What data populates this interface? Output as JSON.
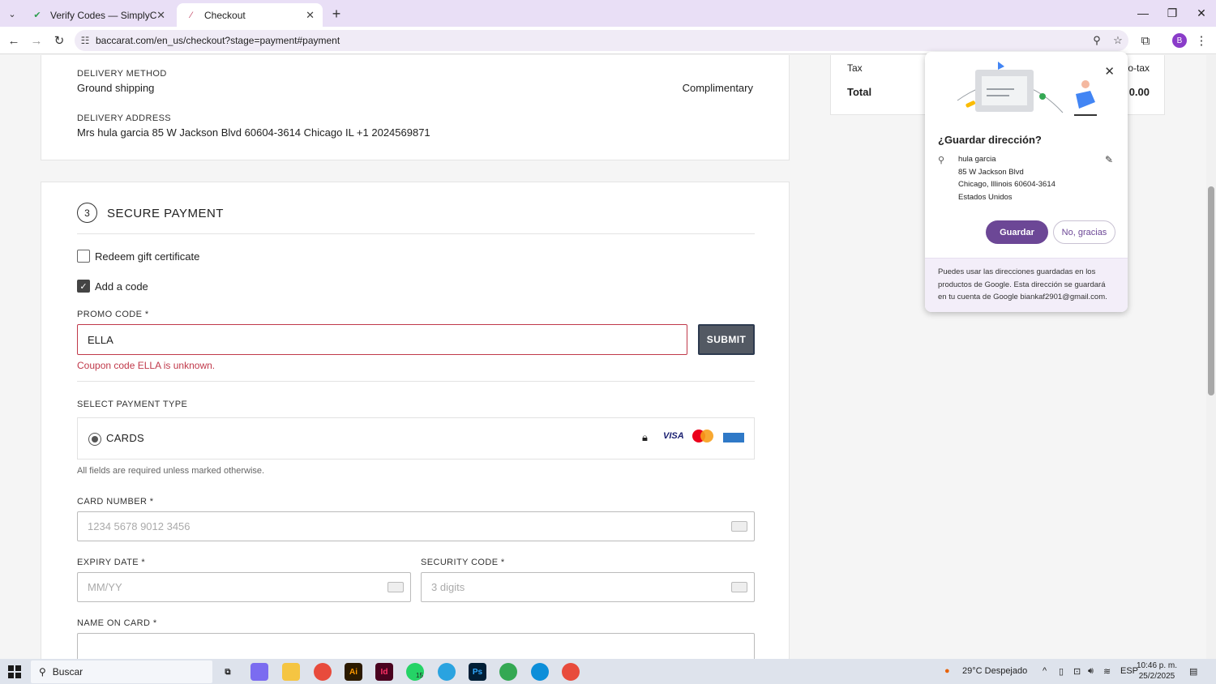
{
  "browser": {
    "tabs": [
      {
        "title": "Verify Codes — SimplyCodes",
        "active": false
      },
      {
        "title": "Checkout",
        "active": true
      }
    ],
    "url": "baccarat.com/en_us/checkout?stage=payment#payment"
  },
  "delivery": {
    "method_label": "DELIVERY METHOD",
    "method_value": "Ground shipping",
    "method_price": "Complimentary",
    "address_label": "DELIVERY ADDRESS",
    "address_value": "Mrs hula garcia 85 W Jackson Blvd 60604-3614 Chicago IL +1 2024569871"
  },
  "summary": {
    "tax_label": "Tax",
    "tax_value_partial": "o-tax",
    "total_label": "Total",
    "total_value_partial": "0.00"
  },
  "payment": {
    "step_number": "3",
    "title": "SECURE PAYMENT",
    "redeem_label": "Redeem gift certificate",
    "add_code_label": "Add a code",
    "promo_label": "PROMO CODE *",
    "promo_value": "ELLA",
    "submit_label": "SUBMIT",
    "promo_error": "Coupon code ELLA is unknown.",
    "select_type_label": "SELECT PAYMENT TYPE",
    "cards_label": "CARDS",
    "card_brands": [
      "VISA",
      "mastercard",
      "AMEX"
    ],
    "required_note": "All fields are required unless marked otherwise.",
    "card_number_label": "CARD NUMBER *",
    "card_number_placeholder": "1234 5678 9012 3456",
    "expiry_label": "EXPIRY DATE *",
    "expiry_placeholder": "MM/YY",
    "security_label": "SECURITY CODE *",
    "security_placeholder": "3 digits",
    "name_label": "NAME ON CARD *"
  },
  "popup": {
    "title": "¿Guardar dirección?",
    "address_lines": [
      "hula garcia",
      "85 W Jackson Blvd",
      "Chicago, Illinois 60604-3614",
      "Estados Unidos"
    ],
    "save_label": "Guardar",
    "decline_label": "No, gracias",
    "footer": "Puedes usar las direcciones guardadas en los productos de Google. Esta dirección se guardará en tu cuenta de Google biankaf2901@gmail.com."
  },
  "taskbar": {
    "search_placeholder": "Buscar",
    "weather": "29°C  Despejado",
    "language": "ESP",
    "time": "10:46 p. m.",
    "date": "25/2/2025",
    "badge_count": "15"
  },
  "colors": {
    "error": "#c0394a",
    "submit_bg": "#535963",
    "google_purple": "#6c4796",
    "tab_strip": "#e9dff6"
  }
}
